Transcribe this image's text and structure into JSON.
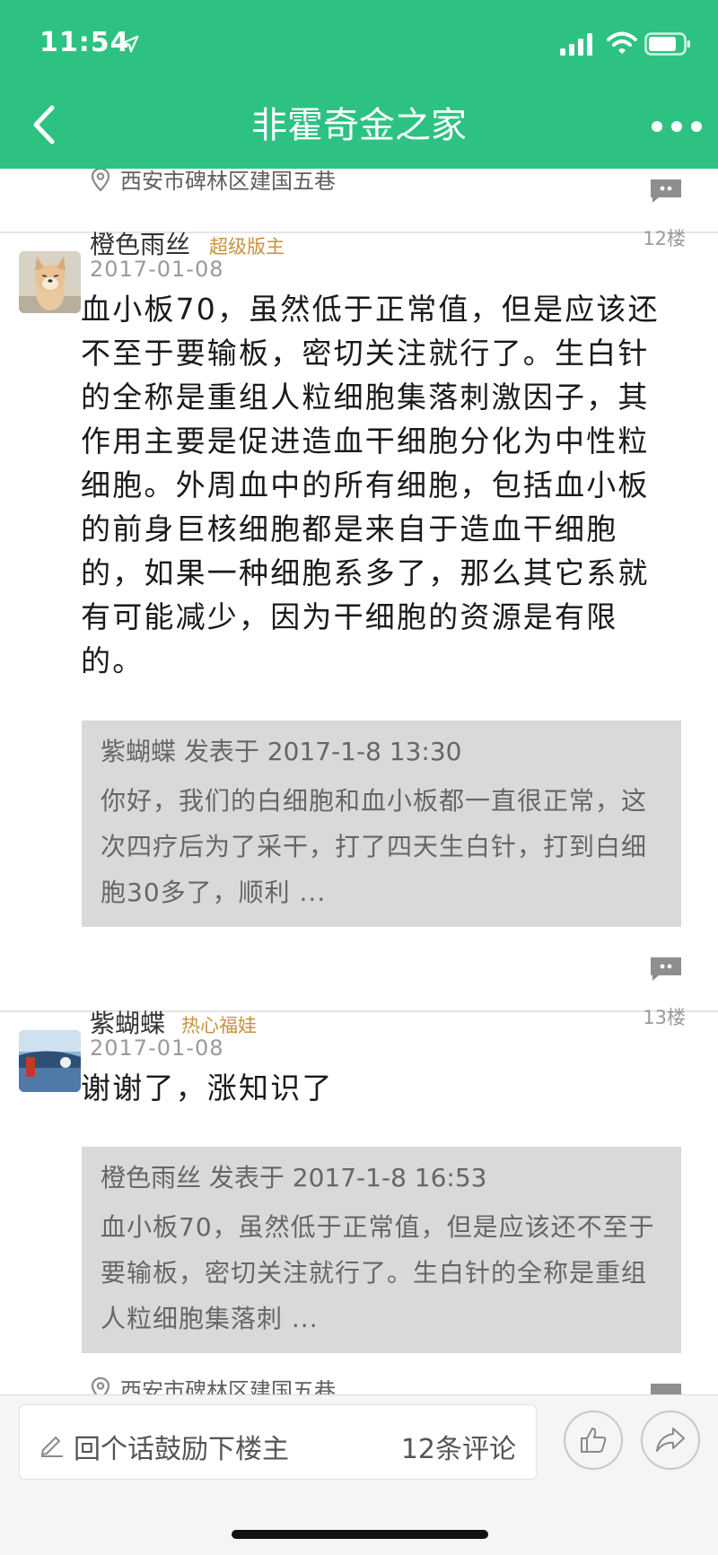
{
  "status_bar": {
    "time": "11:54"
  },
  "nav": {
    "title": "非霍奇金之家"
  },
  "location_text": "西安市碑林区建国五巷",
  "posts": [
    {
      "username": "橙色雨丝",
      "badge": "超级版主",
      "floor": "12楼",
      "date": "2017-01-08",
      "text": "血小板70，虽然低于正常值，但是应该还不至于要输板，密切关注就行了。生白针的全称是重组人粒细胞集落刺激因子，其作用主要是促进造血干细胞分化为中性粒细胞。外周血中的所有细胞，包括血小板的前身巨核细胞都是来自于造血干细胞的，如果一种细胞系多了，那么其它系就有可能减少，因为干细胞的资源是有限的。",
      "quote": {
        "header": "紫蝴蝶 发表于 2017-1-8 13:30",
        "body": "你好，我们的白细胞和血小板都一直很正常，这次四疗后为了采干，打了四天生白针，打到白细胞30多了，顺利 ..."
      }
    },
    {
      "username": "紫蝴蝶",
      "badge": "热心福娃",
      "floor": "13楼",
      "date": "2017-01-08",
      "text": "谢谢了，涨知识了",
      "quote": {
        "header": "橙色雨丝 发表于 2017-1-8 16:53",
        "body": "血小板70，虽然低于正常值，但是应该还不至于要输板，密切关注就行了。生白针的全称是重组人粒细胞集落刺 ..."
      }
    }
  ],
  "bottom_bar": {
    "comment_placeholder": "回个话鼓励下楼主",
    "comment_count": "12条评论"
  },
  "icons": [
    "location-arrow-icon",
    "signal-icon",
    "wifi-icon",
    "battery-icon",
    "back-icon",
    "more-icon",
    "location-pin-icon",
    "reply-icon",
    "pen-icon",
    "thumbs-up-icon",
    "share-icon"
  ],
  "colors": {
    "header_bg": "#2dc282",
    "badge": "#c8933a",
    "quote_bg": "#d9d9d9"
  }
}
